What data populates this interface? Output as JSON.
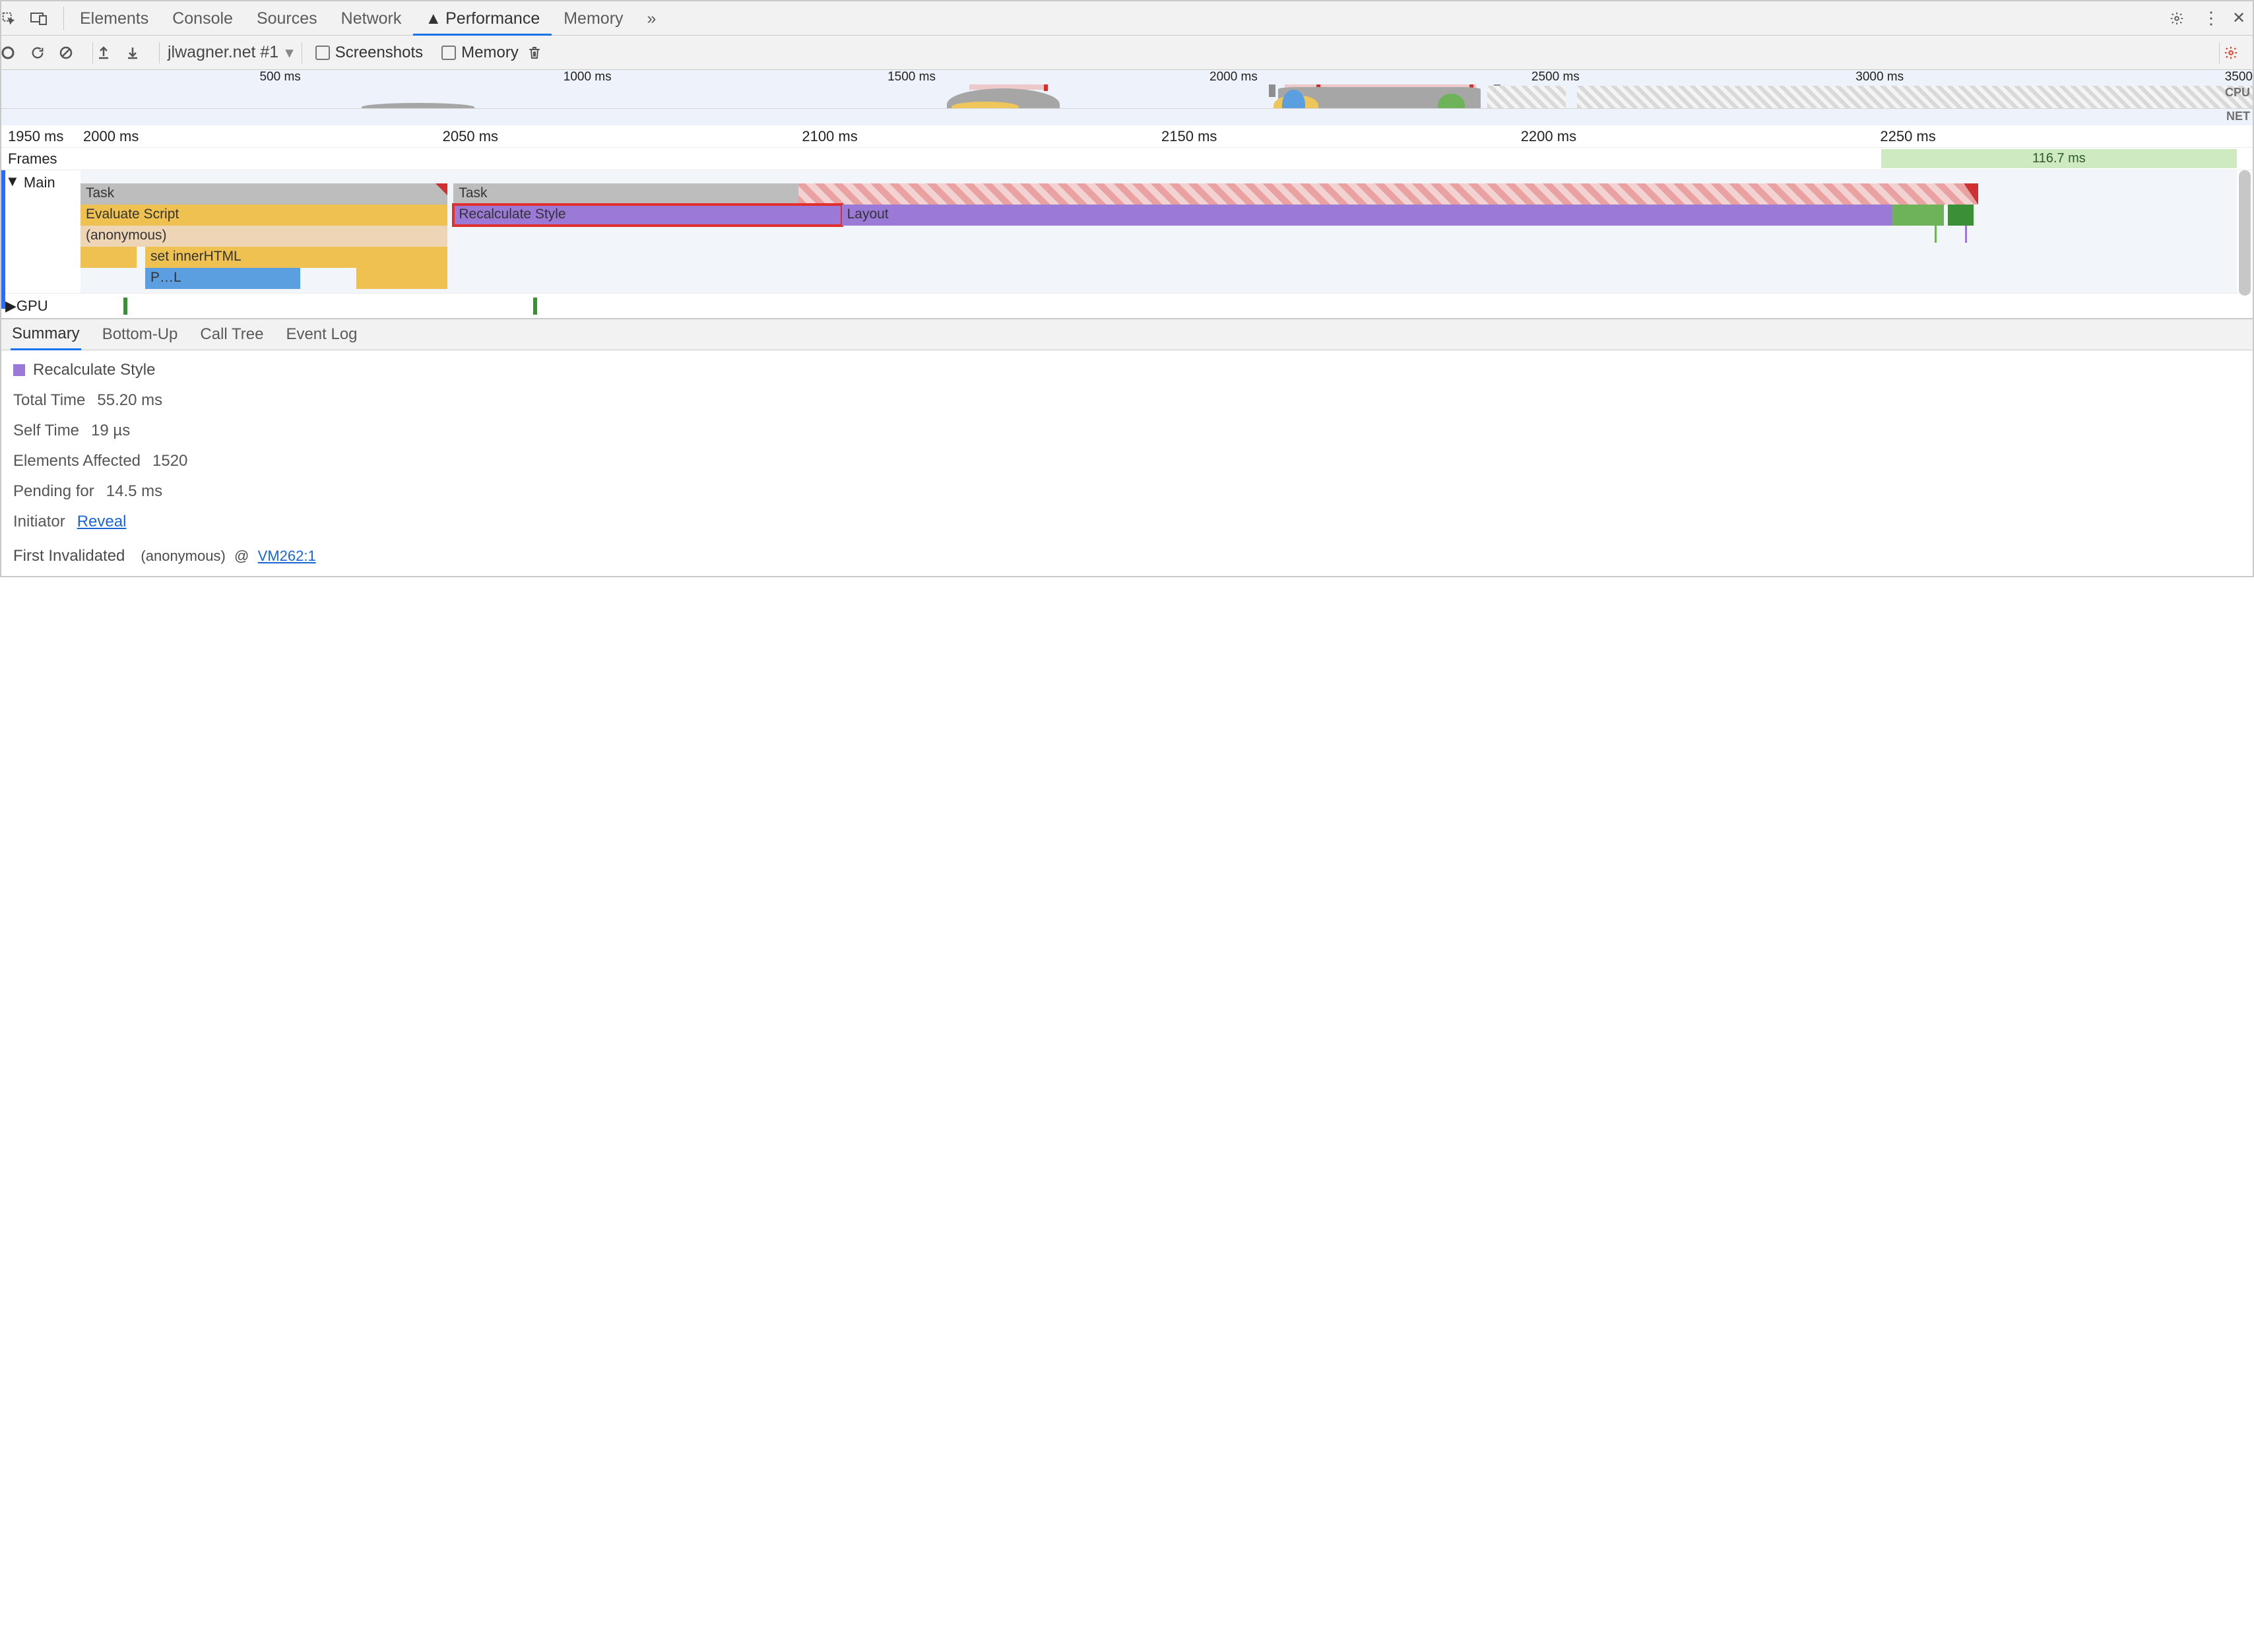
{
  "tabs": {
    "elements": "Elements",
    "console": "Console",
    "sources": "Sources",
    "network": "Network",
    "performance": "Performance",
    "memory": "Memory",
    "more": "»"
  },
  "toolbar": {
    "recording_dropdown": "jlwagner.net #1",
    "screenshots": "Screenshots",
    "memory": "Memory"
  },
  "overview": {
    "ticks": [
      "500 ms",
      "1000 ms",
      "1500 ms",
      "2000 ms",
      "2500 ms",
      "3000 ms",
      "3500"
    ],
    "cpu_label": "CPU",
    "net_label": "NET"
  },
  "ruler": {
    "gutter": "1950 ms",
    "ticks": [
      "2000 ms",
      "2050 ms",
      "2100 ms",
      "2150 ms",
      "2200 ms",
      "2250 ms"
    ]
  },
  "frames": {
    "label": "Frames",
    "badge": "116.7 ms"
  },
  "main": {
    "label": "Main",
    "gpu_label": "GPU",
    "row0": {
      "task1": "Task",
      "task2": "Task"
    },
    "row1": {
      "eval": "Evaluate Script",
      "recalc": "Recalculate Style",
      "layout": "Layout"
    },
    "row2": {
      "anon": "(anonymous)"
    },
    "row3": {
      "inner": "set innerHTML"
    },
    "row4": {
      "pl": "P…L"
    }
  },
  "bottom_tabs": {
    "summary": "Summary",
    "bottom_up": "Bottom-Up",
    "call_tree": "Call Tree",
    "event_log": "Event Log"
  },
  "summary": {
    "title": "Recalculate Style",
    "total_time_k": "Total Time",
    "total_time_v": "55.20 ms",
    "self_time_k": "Self Time",
    "self_time_v": "19 µs",
    "elements_k": "Elements Affected",
    "elements_v": "1520",
    "pending_k": "Pending for",
    "pending_v": "14.5 ms",
    "initiator_k": "Initiator",
    "initiator_link": "Reveal",
    "first_inv_k": "First Invalidated",
    "first_inv_fn": "(anonymous)",
    "first_inv_at": "@",
    "first_inv_src": "VM262:1"
  }
}
